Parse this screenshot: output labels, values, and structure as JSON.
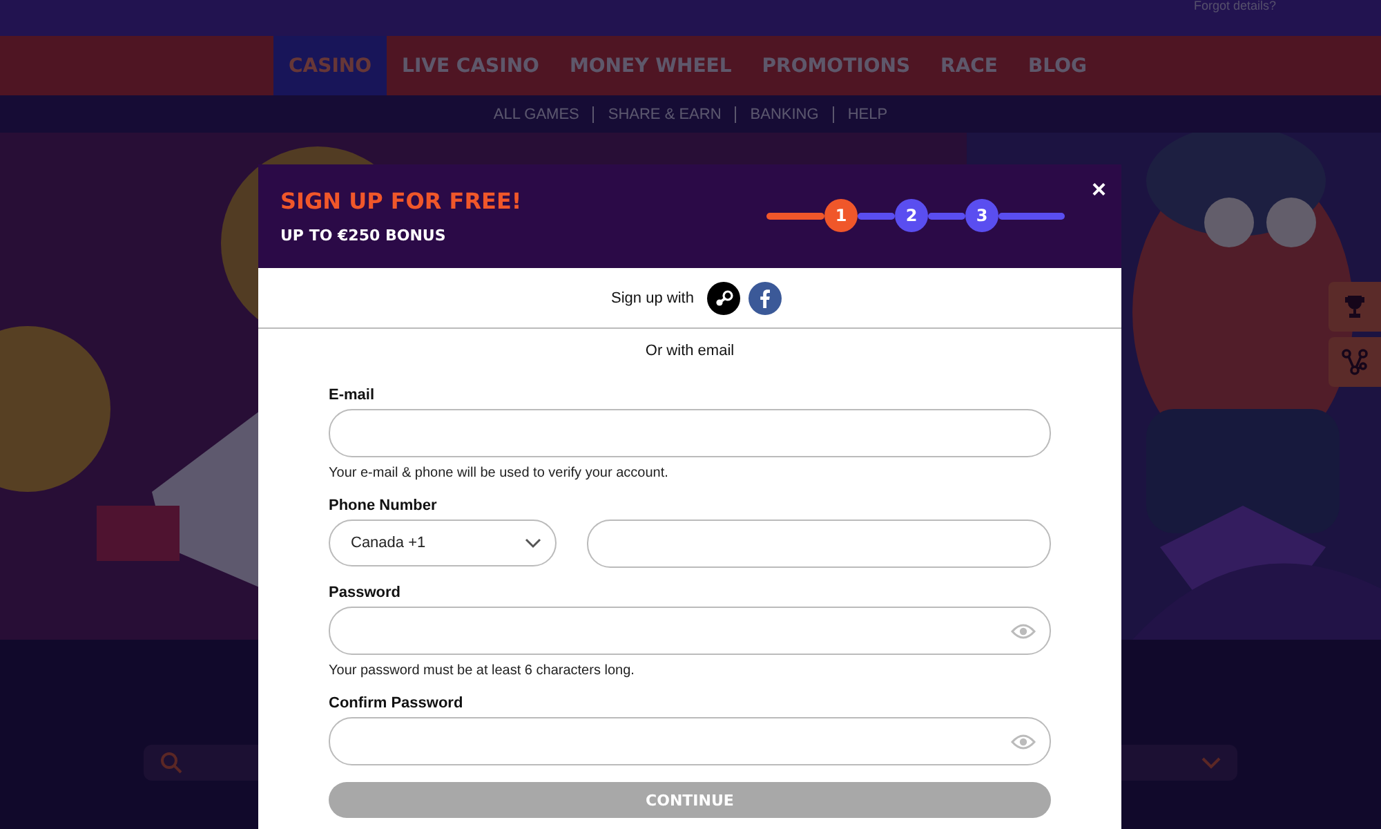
{
  "top_bar": {
    "forgot_link": "Forgot details?"
  },
  "nav": [
    {
      "label": "CASINO",
      "selected": true
    },
    {
      "label": "LIVE CASINO",
      "selected": false
    },
    {
      "label": "MONEY WHEEL",
      "selected": false
    },
    {
      "label": "PROMOTIONS",
      "selected": false
    },
    {
      "label": "RACE",
      "selected": false
    },
    {
      "label": "BLOG",
      "selected": false
    }
  ],
  "subnav": [
    "ALL GAMES",
    "SHARE & EARN",
    "BANKING",
    "HELP"
  ],
  "modal": {
    "title": "SIGN UP FOR FREE!",
    "subtitle": "UP TO €250 BONUS",
    "close": "×",
    "steps": [
      {
        "label": "1",
        "selected": true
      },
      {
        "label": "2",
        "selected": false
      },
      {
        "label": "3",
        "selected": false
      }
    ],
    "social_label": "Sign up with",
    "divider_text": "Or with email",
    "fields": [
      {
        "kind": "text",
        "label": "E-mail",
        "hint": "Your e-mail & phone will be used to verify your account."
      },
      {
        "kind": "phone",
        "label": "Phone Number",
        "country": "Canada +1"
      },
      {
        "kind": "password",
        "label": "Password",
        "hint": "Your password must be at least 6 characters long."
      },
      {
        "kind": "password",
        "label": "Confirm Password"
      }
    ],
    "submit": {
      "label": "CONTINUE",
      "disabled": true
    }
  }
}
